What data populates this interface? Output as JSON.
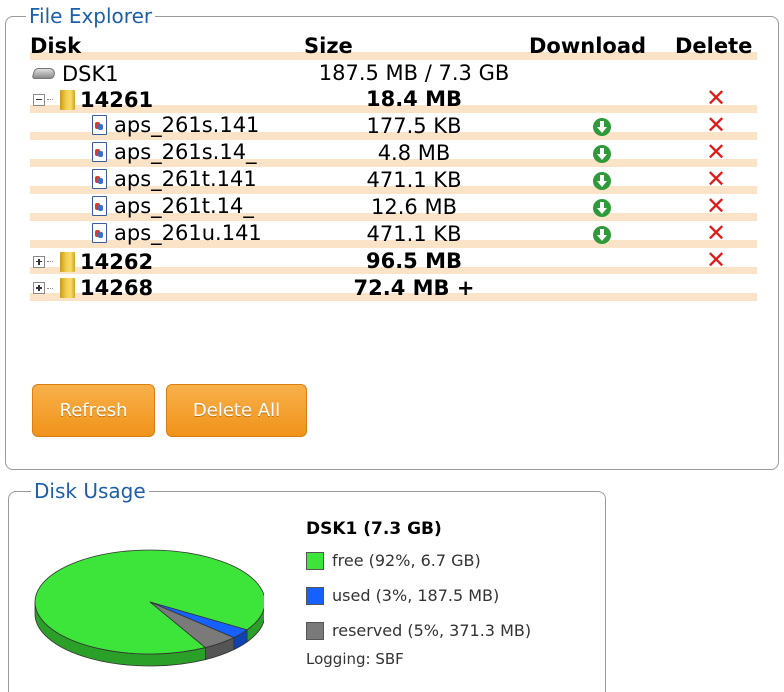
{
  "file_explorer": {
    "title": "File Explorer",
    "headers": {
      "disk": "Disk",
      "size": "Size",
      "download": "Download",
      "delete": "Delete"
    },
    "disk_row": {
      "name": "DSK1",
      "size": "187.5 MB / 7.3 GB"
    },
    "folder_open": {
      "name": "14261",
      "size": "18.4 MB"
    },
    "files": [
      {
        "name": "aps_261s.141",
        "size": "177.5 KB"
      },
      {
        "name": "aps_261s.14_",
        "size": "4.8 MB"
      },
      {
        "name": "aps_261t.141",
        "size": "471.1 KB"
      },
      {
        "name": "aps_261t.14_",
        "size": "12.6 MB"
      },
      {
        "name": "aps_261u.141",
        "size": "471.1 KB"
      }
    ],
    "folder_2": {
      "name": "14262",
      "size": "96.5 MB"
    },
    "folder_3": {
      "name": "14268",
      "size": "72.4 MB +"
    },
    "buttons": {
      "refresh": "Refresh",
      "delete_all": "Delete All"
    },
    "delete_glyph": "✕"
  },
  "disk_usage": {
    "title": "Disk Usage",
    "disk_label": "DSK1 (7.3 GB)",
    "legend": [
      {
        "label": "free (92%, 6.7 GB)",
        "color": "#3de43a"
      },
      {
        "label": "used (3%, 187.5 MB)",
        "color": "#1560ff"
      },
      {
        "label": "reserved (5%, 371.3 MB)",
        "color": "#7a7a7a"
      }
    ],
    "logging": "Logging: SBF"
  },
  "chart_data": {
    "type": "pie",
    "categories": [
      "free",
      "used",
      "reserved"
    ],
    "values": [
      92,
      3,
      5
    ],
    "colors": [
      "#3de43a",
      "#1560ff",
      "#7a7a7a"
    ]
  }
}
